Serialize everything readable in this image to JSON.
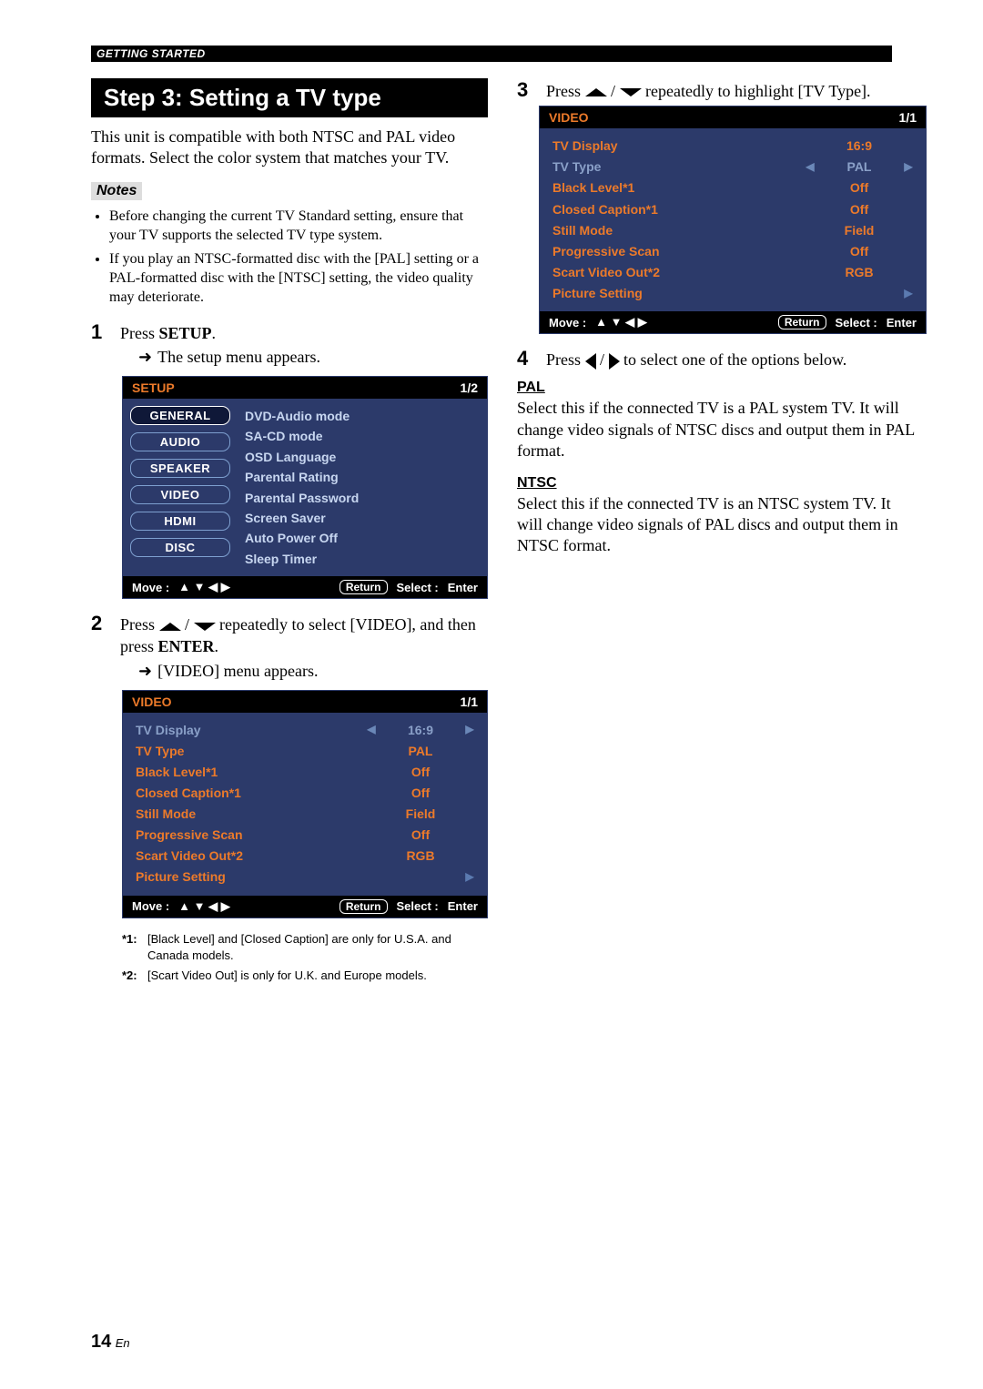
{
  "header": {
    "section": "GETTING STARTED"
  },
  "left": {
    "title": "Step 3: Setting a TV type",
    "intro": "This unit is compatible with both NTSC and PAL video formats. Select the color system that matches your TV.",
    "notes_label": "Notes",
    "notes": [
      "Before changing the current TV Standard setting, ensure that your TV supports the selected TV type system.",
      "If you play an NTSC-formatted disc with the [PAL] setting or a PAL-formatted disc with the [NTSC] setting, the video quality may deteriorate."
    ],
    "step1_prefix": "Press ",
    "step1_bold": "SETUP",
    "step1_suffix": ".",
    "step1_sub": "The setup menu appears.",
    "step2_a": "Press ",
    "step2_b": " / ",
    "step2_c": " repeatedly to select [VIDEO], and then press ",
    "step2_bold": "ENTER",
    "step2_d": ".",
    "step2_sub": "[VIDEO] menu appears.",
    "footnotes": {
      "f1k": "*1:",
      "f1": "[Black Level] and [Closed Caption] are only for U.S.A. and Canada models.",
      "f2k": "*2:",
      "f2": "[Scart Video Out] is only for U.K. and Europe models."
    }
  },
  "osd1": {
    "title": "SETUP",
    "pager": "1/2",
    "tabs": [
      "GENERAL",
      "AUDIO",
      "SPEAKER",
      "VIDEO",
      "HDMI",
      "DISC"
    ],
    "items": [
      "DVD-Audio mode",
      "SA-CD mode",
      "OSD Language",
      "Parental Rating",
      "Parental Password",
      "Screen Saver",
      "Auto Power Off",
      "Sleep Timer"
    ],
    "foot_move": "Move :",
    "foot_arrows": "▲ ▼ ◀ ▶",
    "foot_return": "Return",
    "foot_select": "Select :",
    "foot_enter": "Enter"
  },
  "video_menu": {
    "title": "VIDEO",
    "pager": "1/1",
    "rows": [
      {
        "label": "TV Display",
        "val": "16:9"
      },
      {
        "label": "TV Type",
        "val": "PAL"
      },
      {
        "label": "Black Level",
        "star": "*1",
        "val": "Off"
      },
      {
        "label": "Closed Caption",
        "star": "*1",
        "val": "Off"
      },
      {
        "label": "Still Mode",
        "val": "Field"
      },
      {
        "label": "Progressive Scan",
        "val": "Off"
      },
      {
        "label": "Scart Video Out",
        "star": "*2",
        "val": "RGB"
      },
      {
        "label": "Picture Setting",
        "val": ""
      }
    ]
  },
  "right": {
    "step3_a": "Press ",
    "step3_b": " / ",
    "step3_c": " repeatedly to highlight [TV Type].",
    "step4_a": "Press ",
    "step4_b": " / ",
    "step4_c": " to select one of the options below.",
    "pal_h": "PAL",
    "pal_t": "Select this if the connected TV is a PAL system TV. It will change video signals of NTSC discs and output them in PAL format.",
    "ntsc_h": "NTSC",
    "ntsc_t": "Select this if the connected TV is an NTSC system TV. It will change video signals of PAL discs and output them in NTSC format."
  },
  "page": {
    "num": "14",
    "lang": "En"
  }
}
